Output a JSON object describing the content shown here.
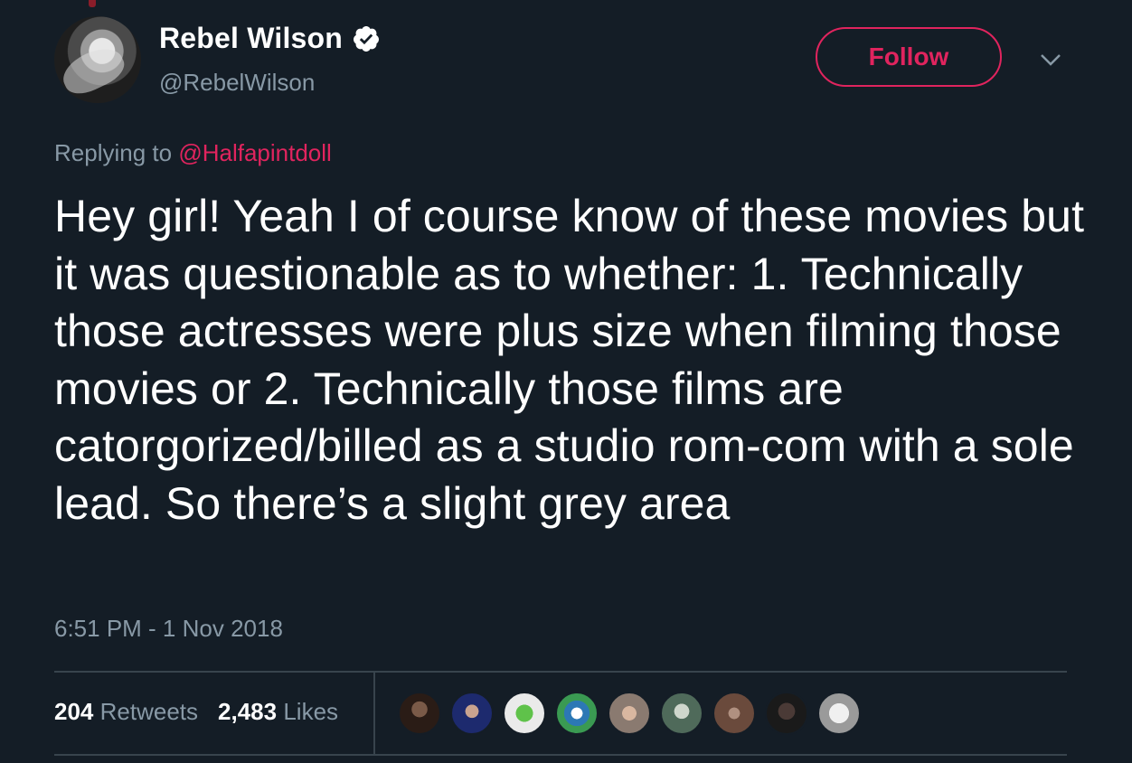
{
  "author": {
    "display_name": "Rebel Wilson",
    "handle": "@RebelWilson",
    "verified": true
  },
  "follow_button": {
    "label": "Follow"
  },
  "reply_context": {
    "prefix": "Replying to",
    "mention": "@Halfapintdoll"
  },
  "tweet": {
    "text": "Hey girl! Yeah I of course know of these movies but it was questionable as to whether: 1. Technically those actresses were plus size when filming those movies or 2. Technically those films are catorgorized/billed as a studio rom-com with a sole lead. So there’s a slight grey area",
    "timestamp": "6:51 PM - 1 Nov 2018"
  },
  "stats": {
    "retweets_count": "204",
    "retweets_label": "Retweets",
    "likes_count": "2,483",
    "likes_label": "Likes"
  },
  "liker_avatars": [
    "avatar-1",
    "avatar-2",
    "avatar-3",
    "avatar-4",
    "avatar-5",
    "avatar-6",
    "avatar-7",
    "avatar-8",
    "avatar-9"
  ],
  "colors": {
    "background": "#141d26",
    "accent": "#e0245e",
    "secondary_text": "#8899a6",
    "divider": "#38444d"
  },
  "icons": [
    "verified-badge-icon",
    "chevron-down-icon"
  ]
}
